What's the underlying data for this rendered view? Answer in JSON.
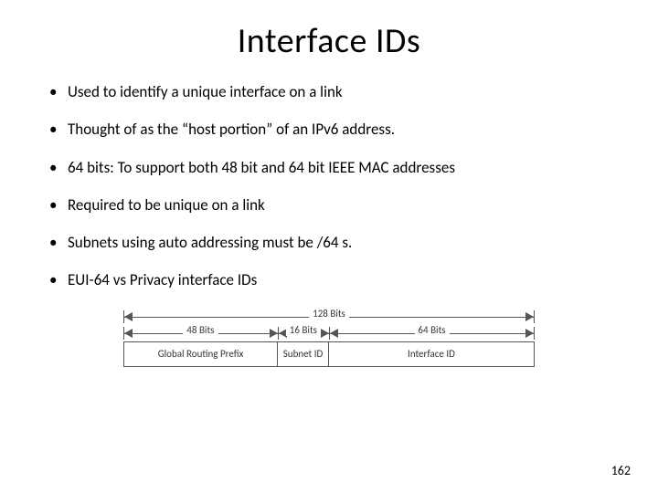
{
  "title": "Interface IDs",
  "bullets": [
    "Used to identify a unique interface on a link",
    "Thought of as the “host portion” of an IPv6 address.",
    "64 bits: To support both 48 bit and 64 bit IEEE MAC addresses",
    "Required to be unique on a link",
    "Subnets using auto addressing must be /64 s.",
    "EUI-64 vs Privacy interface IDs"
  ],
  "diagram": {
    "total_label": "128 Bits",
    "segments": [
      {
        "bits_label": "48 Bits",
        "name": "Global Routing Prefix",
        "width_pct": 37.5
      },
      {
        "bits_label": "16 Bits",
        "name": "Subnet ID",
        "width_pct": 12.5
      },
      {
        "bits_label": "64 Bits",
        "name": "Interface ID",
        "width_pct": 50.0
      }
    ]
  },
  "page_number": "162"
}
